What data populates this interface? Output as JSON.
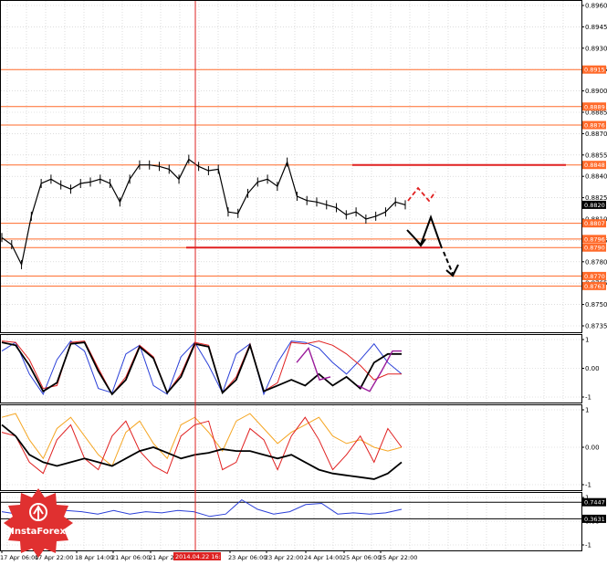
{
  "chart_data": [
    {
      "type": "line",
      "panel": "main-price",
      "yaxis": {
        "ticks": [
          "0.8960",
          "0.8945",
          "0.8930",
          "0.8915",
          "0.8900",
          "0.8885",
          "0.8870",
          "0.8855",
          "0.8840",
          "0.8825",
          "0.8810",
          "0.8795",
          "0.8780",
          "0.8765",
          "0.8750",
          "0.8735"
        ],
        "ylim": [
          0.8735,
          0.896
        ]
      },
      "level_labels": [
        "0.8915",
        "0.8889",
        "0.8876",
        "0.8848",
        "0.8820",
        "0.8807",
        "0.8796",
        "0.8790",
        "0.8770",
        "0.8763"
      ],
      "current_price": "0.8820",
      "series": [
        {
          "values": [
            0.8797,
            0.8792,
            0.8778,
            0.8812,
            0.8835,
            0.8838,
            0.8834,
            0.8831,
            0.8835,
            0.8836,
            0.8838,
            0.8835,
            0.8822,
            0.8838,
            0.8848,
            0.8848,
            0.8847,
            0.8845,
            0.8838,
            0.8852,
            0.8847,
            0.8844,
            0.8845,
            0.8815,
            0.8814,
            0.8828,
            0.8836,
            0.8838,
            0.8833,
            0.885,
            0.8826,
            0.8823,
            0.8822,
            0.882,
            0.8818,
            0.8813,
            0.8815,
            0.881,
            0.8812,
            0.8815,
            0.8822,
            0.882
          ]
        }
      ]
    },
    {
      "type": "line",
      "panel": "oscillator-1",
      "yaxis": {
        "ticks": [
          "1",
          "0.00",
          "-1"
        ],
        "ylim": [
          -1,
          1
        ]
      },
      "series": [
        {
          "values": [
            0.6,
            0.9,
            -0.2,
            -0.9,
            0.3,
            0.95,
            0.6,
            -0.7,
            -0.85,
            0.5,
            0.8,
            -0.6,
            -0.9,
            0.4,
            0.9,
            0.1,
            -0.85,
            0.5,
            0.85,
            -0.9,
            0.2,
            0.95,
            0.9,
            0.7,
            0.2,
            -0.2,
            0.3,
            0.85,
            0.2,
            -0.2
          ]
        },
        {
          "values": [
            0.95,
            0.9,
            0.3,
            -0.7,
            -0.6,
            0.9,
            0.95,
            0.0,
            -0.9,
            -0.3,
            0.8,
            0.4,
            -0.85,
            -0.2,
            0.9,
            0.8,
            -0.85,
            -0.3,
            0.85,
            -0.8,
            -0.5,
            0.9,
            0.85,
            0.95,
            0.8,
            0.5,
            0.1,
            -0.4,
            -0.2,
            -0.2
          ]
        },
        {
          "values": [
            0.9,
            0.8,
            0.1,
            -0.8,
            -0.5,
            0.85,
            0.9,
            -0.1,
            -0.9,
            -0.4,
            0.75,
            0.35,
            -0.85,
            -0.3,
            0.85,
            0.75,
            -0.85,
            -0.4,
            0.8,
            -0.8,
            -0.6,
            -0.4,
            -0.6,
            -0.2,
            -0.6,
            -0.3,
            -0.7,
            0.2,
            0.5,
            0.5
          ]
        }
      ]
    },
    {
      "type": "line",
      "panel": "oscillator-2",
      "yaxis": {
        "ticks": [
          "1",
          "0.00",
          "-1"
        ],
        "ylim": [
          -1,
          1
        ]
      },
      "series": [
        {
          "values": [
            0.8,
            0.9,
            0.2,
            -0.3,
            0.5,
            0.8,
            0.3,
            -0.2,
            -0.5,
            0.4,
            0.7,
            0.1,
            -0.3,
            0.6,
            0.8,
            0.4,
            -0.1,
            0.7,
            0.9,
            0.5,
            0.1,
            0.4,
            0.6,
            0.8,
            0.3,
            0.1,
            0.2,
            0.0,
            -0.1,
            0.0
          ]
        },
        {
          "values": [
            0.4,
            0.3,
            -0.4,
            -0.7,
            0.2,
            0.6,
            -0.3,
            -0.6,
            0.3,
            0.7,
            -0.1,
            -0.5,
            -0.7,
            0.3,
            0.6,
            0.7,
            -0.6,
            -0.4,
            0.5,
            0.2,
            -0.6,
            0.3,
            0.8,
            0.2,
            -0.6,
            -0.2,
            0.3,
            -0.4,
            0.5,
            0.0
          ]
        },
        {
          "values": [
            0.6,
            0.3,
            -0.2,
            -0.4,
            -0.5,
            -0.4,
            -0.3,
            -0.4,
            -0.5,
            -0.3,
            -0.1,
            0.0,
            -0.15,
            -0.3,
            -0.2,
            -0.15,
            -0.05,
            -0.1,
            -0.1,
            -0.2,
            -0.3,
            -0.2,
            -0.4,
            -0.6,
            -0.7,
            -0.75,
            -0.8,
            -0.85,
            -0.7,
            -0.4
          ]
        }
      ]
    },
    {
      "type": "line",
      "panel": "oscillator-3",
      "yaxis": {
        "ticks": [
          "1",
          "0.00",
          "-1"
        ],
        "ylim": [
          -1,
          1
        ]
      },
      "level_labels": [
        "0.7447",
        "0.3631"
      ],
      "series": [
        {
          "values": [
            0.4,
            0.3,
            0.2,
            0.4,
            0.45,
            0.4,
            0.3,
            0.45,
            0.3,
            0.4,
            0.35,
            0.45,
            0.4,
            0.2,
            0.3,
            0.9,
            0.5,
            0.3,
            0.4,
            0.7,
            0.75,
            0.3,
            0.35,
            0.3,
            0.35,
            0.5
          ]
        }
      ]
    }
  ],
  "time_axis": {
    "labels": [
      "17 Apr 06:00",
      "17 Apr 22:00",
      "18 Apr 14:00",
      "21 Apr 06:00",
      "21 Apr 22:00",
      "2014.04.22 16:00",
      "23 Apr 06:00",
      "23 Apr 22:00",
      "24 Apr 14:00",
      "25 Apr 06:00",
      "25 Apr 22:00"
    ],
    "highlighted": "2014.04.22 16:00"
  },
  "logo": {
    "text": "InstaForex"
  },
  "colors": {
    "price": "#000000",
    "level_line": "#ff6a2a",
    "cursor": "#dd2222",
    "grid": "#c8c8c8",
    "series_black": "#000000",
    "series_red": "#e02020",
    "series_blue": "#2a3fd8",
    "series_purple": "#9a1a9a",
    "series_orange": "#f5a623",
    "logo_red": "#e03030"
  }
}
